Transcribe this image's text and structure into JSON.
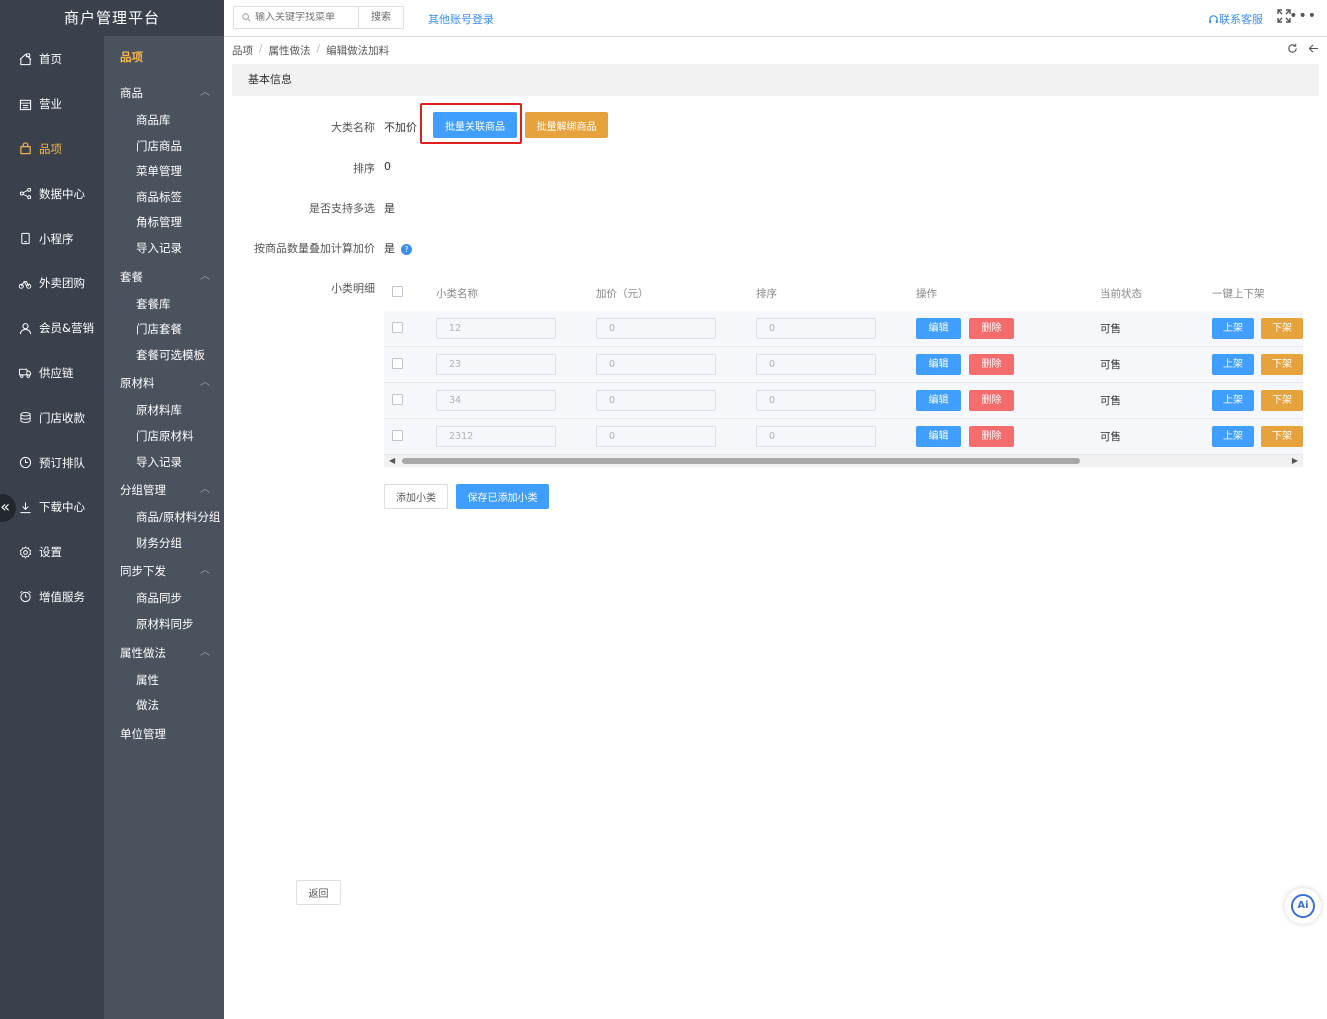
{
  "brand": "商户管理平台",
  "nav1": [
    {
      "label": "首页",
      "icon": "home-icon",
      "active": false
    },
    {
      "label": "营业",
      "icon": "calendar-icon",
      "active": false
    },
    {
      "label": "品项",
      "icon": "bag-icon",
      "active": true
    },
    {
      "label": "数据中心",
      "icon": "share-icon",
      "active": false
    },
    {
      "label": "小程序",
      "icon": "phone-icon",
      "active": false
    },
    {
      "label": "外卖团购",
      "icon": "bike-icon",
      "active": false
    },
    {
      "label": "会员&营销",
      "icon": "user-icon",
      "active": false
    },
    {
      "label": "供应链",
      "icon": "truck-icon",
      "active": false
    },
    {
      "label": "门店收款",
      "icon": "database-icon",
      "active": false
    },
    {
      "label": "预订排队",
      "icon": "clock-icon",
      "active": false
    },
    {
      "label": "下载中心",
      "icon": "download-icon",
      "active": false
    },
    {
      "label": "设置",
      "icon": "gear-icon",
      "active": false
    },
    {
      "label": "增值服务",
      "icon": "alarm-icon",
      "active": false
    }
  ],
  "nav2": {
    "title": "品项",
    "groups": [
      {
        "label": "商品",
        "items": [
          "商品库",
          "门店商品",
          "菜单管理",
          "商品标签",
          "角标管理",
          "导入记录"
        ]
      },
      {
        "label": "套餐",
        "items": [
          "套餐库",
          "门店套餐",
          "套餐可选模板"
        ]
      },
      {
        "label": "原材料",
        "items": [
          "原材料库",
          "门店原材料",
          "导入记录"
        ]
      },
      {
        "label": "分组管理",
        "items": [
          "商品/原材料分组",
          "财务分组"
        ]
      },
      {
        "label": "同步下发",
        "items": [
          "商品同步",
          "原材料同步"
        ]
      },
      {
        "label": "属性做法",
        "items": [
          "属性",
          "做法"
        ]
      }
    ],
    "single": "单位管理"
  },
  "header": {
    "search_placeholder": "输入关键字找菜单",
    "search_button": "搜索",
    "other_login": "其他账号登录",
    "contact": "联系客服"
  },
  "breadcrumb": [
    "品项",
    "属性做法",
    "编辑做法加料"
  ],
  "section_title": "基本信息",
  "form": {
    "category_name_label": "大类名称",
    "category_name_value": "不加价",
    "bind_button": "批量关联商品",
    "unbind_button": "批量解绑商品",
    "sort_label": "排序",
    "sort_value": "0",
    "multi_label": "是否支持多选",
    "multi_value": "是",
    "qty_label": "按商品数量叠加计算加价",
    "qty_value": "是",
    "detail_label": "小类明细"
  },
  "table": {
    "headers": [
      "小类名称",
      "加价（元）",
      "排序",
      "操作",
      "当前状态",
      "一键上下架"
    ],
    "rows": [
      {
        "name": "12",
        "price": "0",
        "sort": "0",
        "status": "可售"
      },
      {
        "name": "23",
        "price": "0",
        "sort": "0",
        "status": "可售"
      },
      {
        "name": "34",
        "price": "0",
        "sort": "0",
        "status": "可售"
      },
      {
        "name": "2312",
        "price": "0",
        "sort": "0",
        "status": "可售"
      }
    ],
    "edit_label": "编辑",
    "delete_label": "删除",
    "on_label": "上架",
    "off_label": "下架"
  },
  "add_sub_button": "添加小类",
  "save_sub_button": "保存已添加小类",
  "back_button": "返回",
  "ai_label": "Ai"
}
